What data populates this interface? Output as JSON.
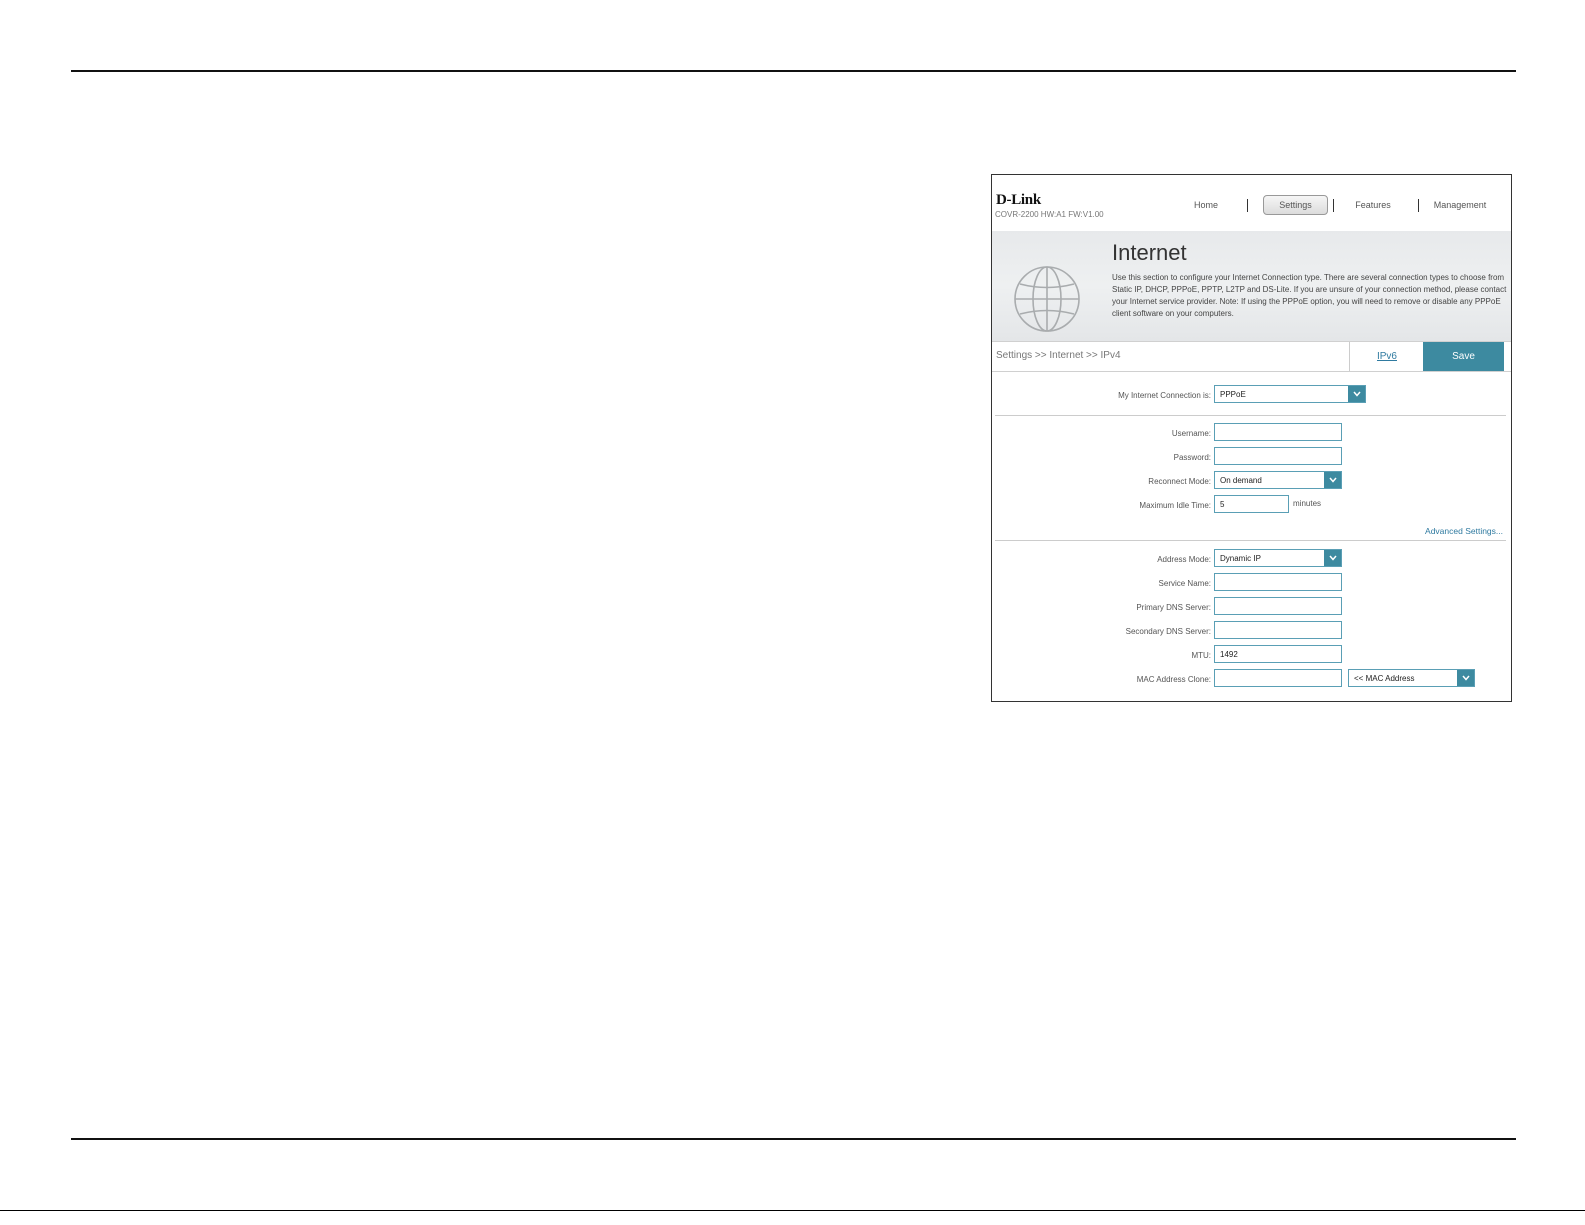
{
  "header": {
    "brand": "D-Link",
    "model": "COVR-2200 HW:A1 FW:V1.00",
    "nav": [
      {
        "label": "Home"
      },
      {
        "label": "Settings"
      },
      {
        "label": "Features"
      },
      {
        "label": "Management"
      }
    ],
    "active_tab": "Settings"
  },
  "banner": {
    "title": "Internet",
    "description": "Use this section to configure your Internet Connection type. There are several connection types to choose from Static IP, DHCP, PPPoE, PPTP, L2TP and DS-Lite. If you are unsure of your connection method, please contact your Internet service provider. Note: If using the PPPoE option, you will need to remove or disable any PPPoE client software on your computers.",
    "icon": "globe-icon"
  },
  "toolbar": {
    "breadcrumb": "Settings >> Internet >> IPv4",
    "ipv6_link": "IPv6",
    "save_label": "Save"
  },
  "form": {
    "connection_label": "My Internet Connection is:",
    "connection_value": "PPPoE",
    "username_label": "Username:",
    "username_value": "",
    "password_label": "Password:",
    "password_value": "",
    "reconnect_label": "Reconnect Mode:",
    "reconnect_value": "On demand",
    "idle_label": "Maximum Idle Time:",
    "idle_value": "5",
    "idle_unit": "minutes",
    "advanced_link": "Advanced Settings...",
    "address_mode_label": "Address Mode:",
    "address_mode_value": "Dynamic IP",
    "service_name_label": "Service Name:",
    "service_name_value": "",
    "primary_dns_label": "Primary DNS Server:",
    "primary_dns_value": "",
    "secondary_dns_label": "Secondary DNS Server:",
    "secondary_dns_value": "",
    "mtu_label": "MTU:",
    "mtu_value": "1492",
    "mac_clone_label": "MAC Address Clone:",
    "mac_clone_value": "",
    "mac_select_value": "<< MAC Address"
  },
  "colors": {
    "accent": "#3d8aa0",
    "link": "#2f7aa0"
  }
}
